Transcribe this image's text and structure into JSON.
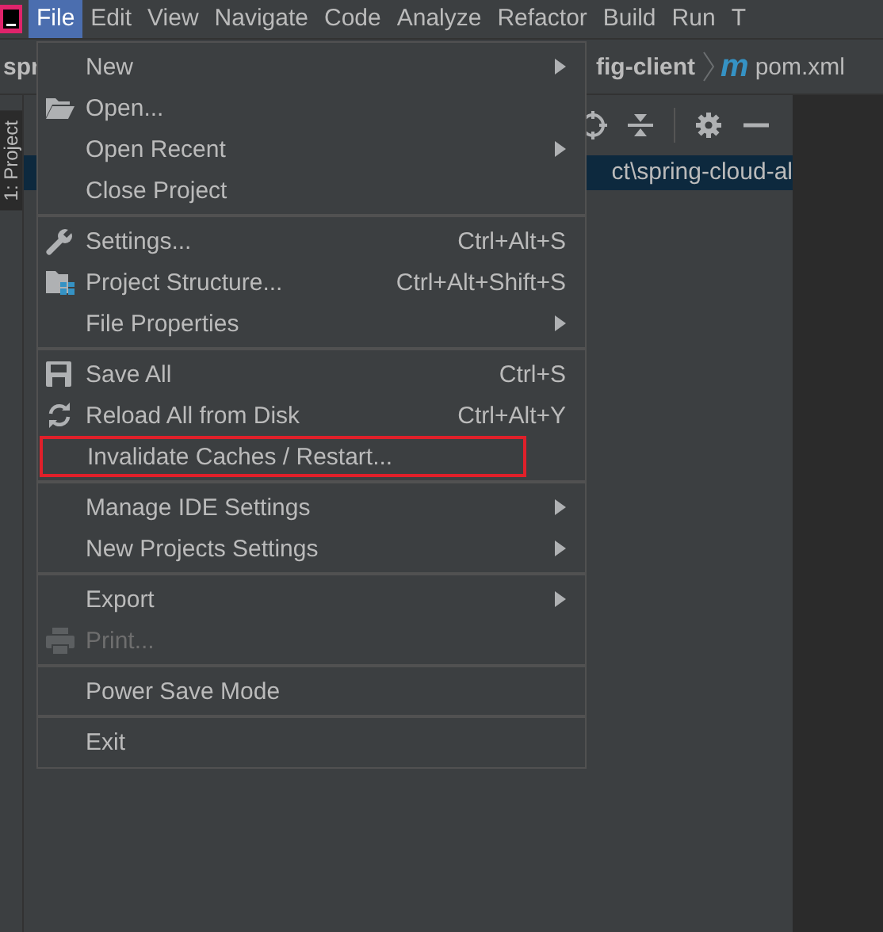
{
  "menubar": [
    {
      "label": "File",
      "selected": true
    },
    {
      "label": "Edit",
      "selected": false
    },
    {
      "label": "View",
      "selected": false
    },
    {
      "label": "Navigate",
      "selected": false
    },
    {
      "label": "Code",
      "selected": false
    },
    {
      "label": "Analyze",
      "selected": false
    },
    {
      "label": "Refactor",
      "selected": false
    },
    {
      "label": "Build",
      "selected": false
    },
    {
      "label": "Run",
      "selected": false
    },
    {
      "label": "T",
      "selected": false
    }
  ],
  "breadcrumb": {
    "project": "spr",
    "module": "fig-client",
    "file_badge": "m",
    "file": "pom.xml"
  },
  "tool_window_tab": "1: Project",
  "project_row": {
    "text": "ct\\spring-cloud-al",
    "selected": true
  },
  "menu": {
    "sections": [
      [
        {
          "label": "New",
          "submenu": true,
          "disabled": false,
          "highlighted": false
        },
        {
          "label": "Open...",
          "submenu": false,
          "disabled": false,
          "highlighted": false
        },
        {
          "label": "Open Recent",
          "submenu": true,
          "disabled": false,
          "highlighted": false
        },
        {
          "label": "Close Project",
          "submenu": false,
          "disabled": false,
          "highlighted": false
        }
      ],
      [
        {
          "label": "Settings...",
          "shortcut": "Ctrl+Alt+S",
          "submenu": false,
          "disabled": false,
          "highlighted": false
        },
        {
          "label": "Project Structure...",
          "shortcut": "Ctrl+Alt+Shift+S",
          "submenu": false,
          "disabled": false,
          "highlighted": false
        },
        {
          "label": "File Properties",
          "submenu": true,
          "disabled": false,
          "highlighted": false
        }
      ],
      [
        {
          "label": "Save All",
          "shortcut": "Ctrl+S",
          "submenu": false,
          "disabled": false,
          "highlighted": false
        },
        {
          "label": "Reload All from Disk",
          "shortcut": "Ctrl+Alt+Y",
          "submenu": false,
          "disabled": false,
          "highlighted": false
        },
        {
          "label": "Invalidate Caches / Restart...",
          "submenu": false,
          "disabled": false,
          "highlighted": true
        }
      ],
      [
        {
          "label": "Manage IDE Settings",
          "submenu": true,
          "disabled": false,
          "highlighted": false
        },
        {
          "label": "New Projects Settings",
          "submenu": true,
          "disabled": false,
          "highlighted": false
        }
      ],
      [
        {
          "label": "Export",
          "submenu": true,
          "disabled": false,
          "highlighted": false
        },
        {
          "label": "Print...",
          "submenu": false,
          "disabled": true,
          "highlighted": false
        }
      ],
      [
        {
          "label": "Power Save Mode",
          "submenu": false,
          "disabled": false,
          "highlighted": false
        }
      ],
      [
        {
          "label": "Exit",
          "submenu": false,
          "disabled": false,
          "highlighted": false
        }
      ]
    ]
  }
}
